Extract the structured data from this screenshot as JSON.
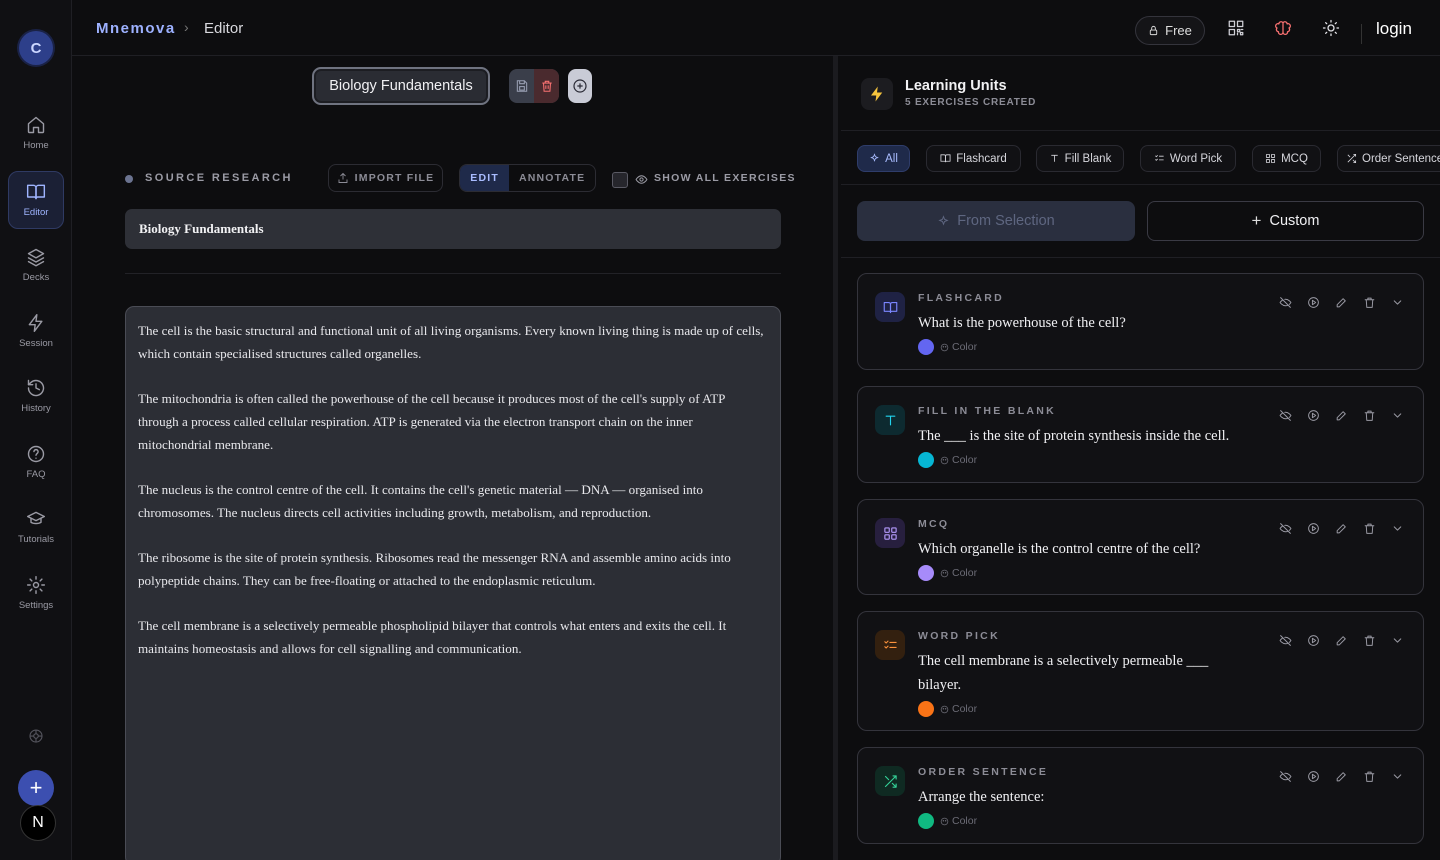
{
  "app": {
    "brand": "Mnemova",
    "breadcrumb_current": "Editor"
  },
  "rail": {
    "avatar_letter": "C",
    "items": [
      {
        "label": "Home",
        "icon": "home-icon"
      },
      {
        "label": "Editor",
        "icon": "book-open-icon",
        "active": true
      },
      {
        "label": "Decks",
        "icon": "layers-icon"
      },
      {
        "label": "Session",
        "icon": "zap-icon"
      },
      {
        "label": "History",
        "icon": "history-icon"
      },
      {
        "label": "FAQ",
        "icon": "help-circle-icon"
      },
      {
        "label": "Tutorials",
        "icon": "graduation-cap-icon"
      },
      {
        "label": "Settings",
        "icon": "settings-icon"
      }
    ],
    "bottom_plus": "+",
    "bottom_badge": "N"
  },
  "topbar": {
    "plan_label": "Free",
    "icons": [
      "qr-code-icon",
      "brain-icon",
      "sun-icon"
    ],
    "login_label": "login"
  },
  "editor": {
    "doc_title": "Biology Fundamentals",
    "source_label": "SOURCE RESEARCH",
    "import_label": "IMPORT FILE",
    "mode_edit": "EDIT",
    "mode_annotate": "ANNOTATE",
    "show_all_label": "SHOW ALL EXERCISES",
    "title_field": "Biology Fundamentals",
    "paragraphs": [
      "The cell is the basic structural and functional unit of all living organisms. Every known living thing is made up of cells, which contain specialised structures called organelles.",
      "The mitochondria is often called the powerhouse of the cell because it produces most of the cell's supply of ATP through a process called cellular respiration. ATP is generated via the electron transport chain on the inner mitochondrial membrane.",
      "The nucleus is the control centre of the cell. It contains the cell's genetic material — DNA — organised into chromosomes. The nucleus directs cell activities including growth, metabolism, and reproduction.",
      "The ribosome is the site of protein synthesis. Ribosomes read the messenger RNA and assemble amino acids into polypeptide chains. They can be free-floating or attached to the endoplasmic reticulum.",
      "The cell membrane is a selectively permeable phospholipid bilayer that controls what enters and exits the cell. It maintains homeostasis and allows for cell signalling and communication."
    ]
  },
  "units": {
    "title": "Learning Units",
    "subtitle": "5 EXERCISES CREATED",
    "filters": [
      {
        "label": "All",
        "icon": "sparkles-icon",
        "active": true
      },
      {
        "label": "Flashcard",
        "icon": "book-open-icon"
      },
      {
        "label": "Fill Blank",
        "icon": "type-icon"
      },
      {
        "label": "Word Pick",
        "icon": "list-check-icon"
      },
      {
        "label": "MCQ",
        "icon": "grid-icon"
      },
      {
        "label": "Order Sentence",
        "icon": "shuffle-icon"
      }
    ],
    "from_selection_label": "From Selection",
    "custom_label": "Custom",
    "custom_prefix": "+",
    "color_label": "Color",
    "cards": [
      {
        "type": "FLASHCARD",
        "question": "What is the powerhouse of the cell?",
        "color": "#6366f1",
        "icon": "book-open-icon",
        "icon_color": "#7b86ff",
        "icon_bg": "#1f2244"
      },
      {
        "type": "FILL IN THE BLANK",
        "question": "The ___ is the site of protein synthesis inside the cell.",
        "color": "#06b6d4",
        "icon": "type-icon",
        "icon_color": "#22d3ee",
        "icon_bg": "#0d2a30"
      },
      {
        "type": "MCQ",
        "question": "Which organelle is the control centre of the cell?",
        "color": "#a78bfa",
        "icon": "grid-icon",
        "icon_color": "#b69cff",
        "icon_bg": "#271f3e"
      },
      {
        "type": "WORD PICK",
        "question": "The cell membrane is a selectively permeable ___ bilayer.",
        "color": "#f97316",
        "icon": "list-check-icon",
        "icon_color": "#fb923c",
        "icon_bg": "#33200f"
      },
      {
        "type": "ORDER SENTENCE",
        "question": "Arrange the sentence:",
        "color": "#10b981",
        "icon": "shuffle-icon",
        "icon_color": "#34d399",
        "icon_bg": "#0f2a22"
      }
    ]
  }
}
